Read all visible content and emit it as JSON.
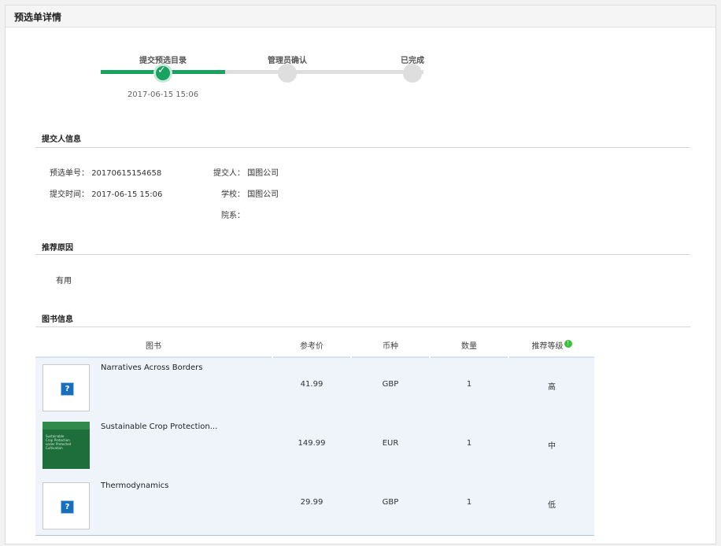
{
  "header": {
    "title": "预选单详情"
  },
  "steps": [
    {
      "label": "提交预选目录",
      "time": "2017-06-15 15:06",
      "status": "done",
      "icon": "check-icon"
    },
    {
      "label": "管理员确认",
      "status": "pending"
    },
    {
      "label": "已完成",
      "status": "pending"
    }
  ],
  "submitter": {
    "title": "提交人信息",
    "order_no_label": "预选单号：",
    "order_no": "20170615154658",
    "submit_time_label": "提交时间：",
    "submit_time": "2017-06-15 15:06",
    "submitter_label": "提交人：",
    "submitter": "国图公司",
    "school_label": "学校：",
    "school": "国图公司",
    "dept_label": "院系：",
    "dept": ""
  },
  "reason": {
    "title": "推荐原因",
    "text": "有用"
  },
  "books": {
    "title": "图书信息",
    "columns": [
      "图书",
      "参考价",
      "币种",
      "数量",
      "推荐等级"
    ],
    "info_icon": "info-icon",
    "rows": [
      {
        "title": "Narratives Across Borders",
        "price": "41.99",
        "currency": "GBP",
        "qty": "1",
        "level": "高",
        "cover": "placeholder"
      },
      {
        "title": "Sustainable Crop Protection...",
        "price": "149.99",
        "currency": "EUR",
        "qty": "1",
        "level": "中",
        "cover": "image"
      },
      {
        "title": "Thermodynamics",
        "price": "29.99",
        "currency": "GBP",
        "qty": "1",
        "level": "低",
        "cover": "placeholder"
      }
    ],
    "placeholder_glyph": "?"
  },
  "colors": {
    "accent_green": "#1aa261",
    "table_bg": "#eef4fa",
    "track_grey": "#dedede"
  }
}
